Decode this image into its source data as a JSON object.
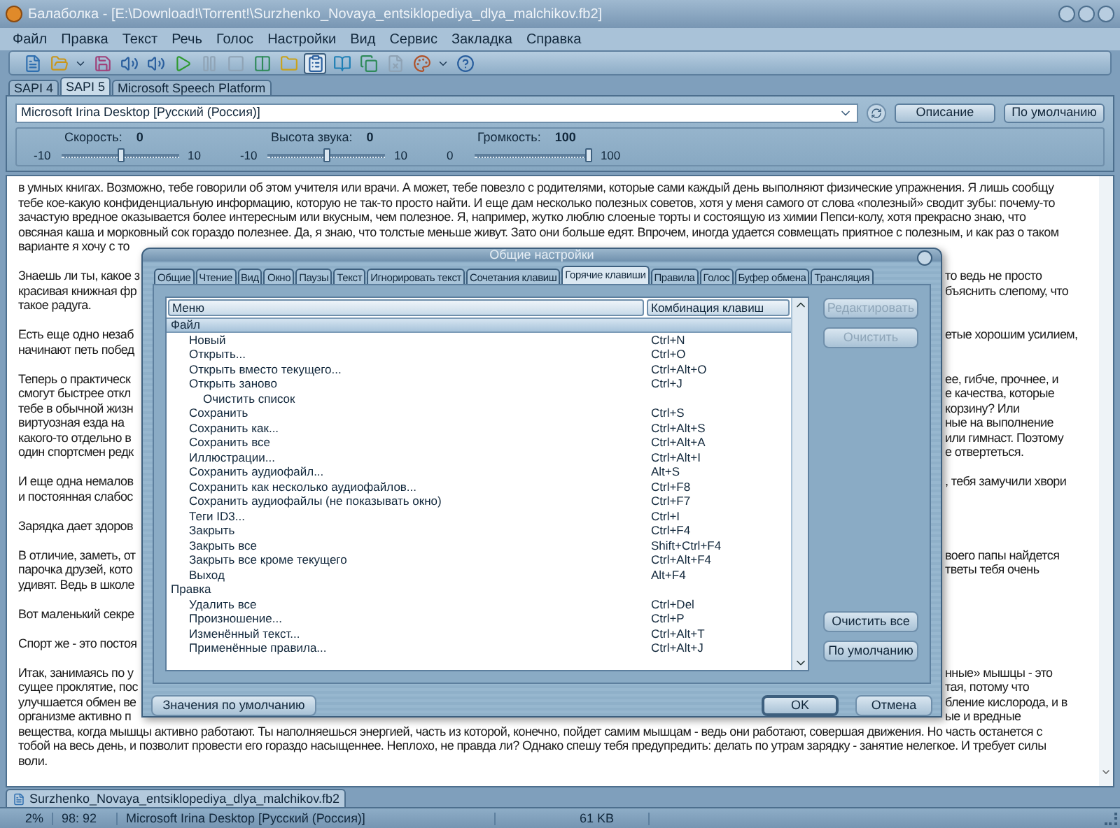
{
  "window": {
    "title": "Балаболка - [E:\\Download!\\Torrent!\\Surzhenko_Novaya_entsiklopediya_dlya_malchikov.fb2]"
  },
  "menu": [
    "Файл",
    "Правка",
    "Текст",
    "Речь",
    "Голос",
    "Настройки",
    "Вид",
    "Сервис",
    "Закладка",
    "Справка"
  ],
  "toolbar": [
    {
      "kind": "document",
      "disabled": false,
      "pressed": false
    },
    {
      "kind": "folder",
      "disabled": false,
      "pressed": false
    },
    {
      "kind": "caret",
      "disabled": false,
      "pressed": false
    },
    {
      "kind": "save",
      "disabled": false,
      "pressed": false
    },
    {
      "kind": "audio",
      "disabled": false,
      "pressed": false
    },
    {
      "kind": "audio",
      "disabled": false,
      "pressed": false
    },
    {
      "kind": "play",
      "disabled": false,
      "pressed": false
    },
    {
      "kind": "pause",
      "disabled": true,
      "pressed": false
    },
    {
      "kind": "stop",
      "disabled": true,
      "pressed": false
    },
    {
      "kind": "columns",
      "disabled": false,
      "pressed": false
    },
    {
      "kind": "folder2",
      "disabled": false,
      "pressed": false
    },
    {
      "kind": "clipboard",
      "disabled": false,
      "pressed": true
    },
    {
      "kind": "book",
      "disabled": false,
      "pressed": false
    },
    {
      "kind": "copy",
      "disabled": false,
      "pressed": false
    },
    {
      "kind": "filex",
      "disabled": true,
      "pressed": false
    },
    {
      "kind": "palette",
      "disabled": false,
      "pressed": false
    },
    {
      "kind": "caret",
      "disabled": false,
      "pressed": false
    },
    {
      "kind": "help",
      "disabled": false,
      "pressed": false
    }
  ],
  "engine_tabs": [
    {
      "label": "SAPI 4",
      "selected": false
    },
    {
      "label": "SAPI 5",
      "selected": true
    },
    {
      "label": "Microsoft Speech Platform",
      "selected": false
    }
  ],
  "voice": {
    "value": "Microsoft Irina Desktop [Русский (Россия)]",
    "buttons": [
      "Описание",
      "По умолчанию"
    ]
  },
  "sliders": [
    {
      "label": "Скорость:",
      "value": "0",
      "min": "-10",
      "max": "10",
      "level": 0.5
    },
    {
      "label": "Высота звука:",
      "value": "0",
      "min": "-10",
      "max": "10",
      "level": 0.5
    },
    {
      "label": "Громкость:",
      "value": "100",
      "min": "0",
      "max": "100",
      "level": 1
    }
  ],
  "document": {
    "paragraphs": [
      [
        {
          "kind": "full",
          "text": "в умных книгах. Возможно, тебе говорили об этом учителя или врачи. А может, тебе повезло с родителями, которые сами каждый день выполняют физические упражнения. Я лишь сообщу"
        },
        {
          "kind": "full",
          "text": "тебе кое-какую конфиденциальную информацию, которую не так-то просто найти. И еще дам несколько полезных советов, хотя у меня самого от слова «полезный» сводит зубы: почему-то"
        },
        {
          "kind": "full",
          "text": "зачастую вредное оказывается более интересным или вкусным, чем полезное. Я, например, жутко люблю слоеные торты и состоящую из химии Пепси-колу, хотя прекрасно знаю, что"
        },
        {
          "kind": "full",
          "text": "овсяная каша и морковный сок гораздо полезнее. Да, я знаю, что толстые меньше живут. Зато они больше едят. Впрочем, иногда удается совмещать приятное с полезным, и как раз о таком"
        },
        {
          "kind": "covered",
          "left": "варианте я хочу с то"
        }
      ],
      [
        {
          "kind": "covered",
          "left": "Знаешь ли ты, какое з",
          "right": "то ведь не просто"
        },
        {
          "kind": "covered",
          "left": "красивая книжная фр",
          "right": "бъяснить слепому, что"
        },
        {
          "kind": "covered",
          "left": "такое радуга."
        }
      ],
      [
        {
          "kind": "covered",
          "left": "Есть еще одно незаб",
          "right": "етые хорошим усилием,"
        },
        {
          "kind": "covered",
          "left": "начинают петь побед"
        }
      ],
      [
        {
          "kind": "covered",
          "left": "Теперь о практическ",
          "right": "ее, гибче, прочнее, и"
        },
        {
          "kind": "covered",
          "left": "смогут быстрее откл",
          "right": "е качества, которые"
        },
        {
          "kind": "covered",
          "left": "тебе в обычной жизн",
          "right": "корзину? Или"
        },
        {
          "kind": "covered",
          "left": "виртуозная езда на",
          "right": "ные на выполнение"
        },
        {
          "kind": "covered",
          "left": "какого-то отдельно в",
          "right": "или гимнаст. Поэтому"
        },
        {
          "kind": "covered",
          "left": "один спортсмен редк",
          "right": "е отвертеться."
        }
      ],
      [
        {
          "kind": "covered",
          "left": "И еще одна немалов",
          "right": ", тебя замучили хвори"
        },
        {
          "kind": "covered",
          "left": "и постоянная слабос"
        }
      ],
      [
        {
          "kind": "covered",
          "left": "Зарядка дает здоров"
        }
      ],
      [
        {
          "kind": "covered",
          "left": "В отличие, заметь, от",
          "right": "воего папы найдется"
        },
        {
          "kind": "covered",
          "left": "парочка друзей, кото",
          "right": "тветы тебя очень"
        },
        {
          "kind": "covered",
          "left": "удивят. Ведь в школе"
        }
      ],
      [
        {
          "kind": "covered",
          "left": "Вот маленький секре"
        }
      ],
      [
        {
          "kind": "covered",
          "left": "Спорт же - это постоя"
        }
      ],
      [
        {
          "kind": "covered",
          "left": "Итак, занимаясь по у",
          "right": "нные» мышцы - это"
        },
        {
          "kind": "covered",
          "left": "сущее проклятие, пос",
          "right": "тая, потому что"
        },
        {
          "kind": "covered",
          "left": "улучшается обмен ве",
          "right": "бление кислорода, и в"
        },
        {
          "kind": "covered",
          "left": "организме активно п",
          "right": "ые и вредные"
        },
        {
          "kind": "full",
          "text": "вещества, когда мышцы активно работают. Ты наполняешься энергией, часть из которой, конечно, пойдет самим мышцам - ведь они работают, совершая движения. Но часть останется с"
        },
        {
          "kind": "full",
          "text": "тобой на весь день, и позволит провести его гораздо насыщеннее. Неплохо, не правда ли? Однако спешу тебя предупредить: делать по утрам зарядку - занятие нелегкое. И требует силы"
        },
        {
          "kind": "full",
          "text": "воли."
        }
      ]
    ]
  },
  "document_tab": "Surzhenko_Novaya_entsiklopediya_dlya_malchikov.fb2",
  "status_bar": [
    "2%",
    "98: 92",
    "Microsoft Irina Desktop [Русский (Россия)]",
    "61 KB"
  ],
  "dialog": {
    "title": "Общие настройки",
    "tabs": [
      {
        "label": "Общие",
        "selected": false
      },
      {
        "label": "Чтение",
        "selected": false
      },
      {
        "label": "Вид",
        "selected": false
      },
      {
        "label": "Окно",
        "selected": false
      },
      {
        "label": "Паузы",
        "selected": false
      },
      {
        "label": "Текст",
        "selected": false
      },
      {
        "label": "Игнорировать текст",
        "selected": false
      },
      {
        "label": "Сочетания клавиш",
        "selected": false
      },
      {
        "label": "Горячие клавиши",
        "selected": true
      },
      {
        "label": "Правила",
        "selected": false
      },
      {
        "label": "Голос",
        "selected": false
      },
      {
        "label": "Буфер обмена",
        "selected": false
      },
      {
        "label": "Трансляция",
        "selected": false
      }
    ],
    "columns": [
      "Меню",
      "Комбинация клавиш"
    ],
    "tree": [
      {
        "label": "Файл",
        "selected": true,
        "children": [
          {
            "label": "Новый",
            "shortcut": "Ctrl+N",
            "selected": false
          },
          {
            "label": "Открыть...",
            "shortcut": "Ctrl+O",
            "selected": false
          },
          {
            "label": "Открыть вместо текущего...",
            "shortcut": "Ctrl+Alt+O",
            "selected": false
          },
          {
            "label": "Открыть заново",
            "shortcut": "Ctrl+J",
            "selected": false,
            "children": [
              {
                "label": "Очистить список",
                "selected": false
              }
            ]
          },
          {
            "label": "Сохранить",
            "shortcut": "Ctrl+S",
            "selected": false
          },
          {
            "label": "Сохранить как...",
            "shortcut": "Ctrl+Alt+S",
            "selected": false
          },
          {
            "label": "Сохранить все",
            "shortcut": "Ctrl+Alt+A",
            "selected": false
          },
          {
            "label": "Иллюстрации...",
            "shortcut": "Ctrl+Alt+I",
            "selected": false
          },
          {
            "label": "Сохранить аудиофайл...",
            "shortcut": "Alt+S",
            "selected": false
          },
          {
            "label": "Сохранить как несколько аудиофайлов...",
            "shortcut": "Ctrl+F8",
            "selected": false
          },
          {
            "label": "Сохранить аудиофайлы (не показывать окно)",
            "shortcut": "Ctrl+F7",
            "selected": false
          },
          {
            "label": "Теги ID3...",
            "shortcut": "Ctrl+I",
            "selected": false
          },
          {
            "label": "Закрыть",
            "shortcut": "Ctrl+F4",
            "selected": false
          },
          {
            "label": "Закрыть все",
            "shortcut": "Shift+Ctrl+F4",
            "selected": false
          },
          {
            "label": "Закрыть все кроме текущего",
            "shortcut": "Ctrl+Alt+F4",
            "selected": false
          },
          {
            "label": "Выход",
            "shortcut": "Alt+F4",
            "selected": false
          }
        ]
      },
      {
        "label": "Правка",
        "selected": false,
        "children": [
          {
            "label": "Удалить все",
            "shortcut": "Ctrl+Del",
            "selected": false
          },
          {
            "label": "Произношение...",
            "shortcut": "Ctrl+P",
            "selected": false
          },
          {
            "label": "Изменённый текст...",
            "shortcut": "Ctrl+Alt+T",
            "selected": false
          },
          {
            "label": "Применённые правила...",
            "shortcut": "Ctrl+Alt+J",
            "selected": false
          }
        ]
      }
    ],
    "side_buttons_top": [
      {
        "label": "Редактировать",
        "disabled": true
      },
      {
        "label": "Очистить",
        "disabled": true
      }
    ],
    "side_buttons_bottom": [
      {
        "label": "Очистить все",
        "disabled": false
      },
      {
        "label": "По умолчанию",
        "disabled": false
      }
    ],
    "footer_left": {
      "label": "Значения по умолчанию",
      "default": false
    },
    "footer_right": [
      {
        "label": "OK",
        "default": true
      },
      {
        "label": "Отмена",
        "default": false
      }
    ]
  }
}
